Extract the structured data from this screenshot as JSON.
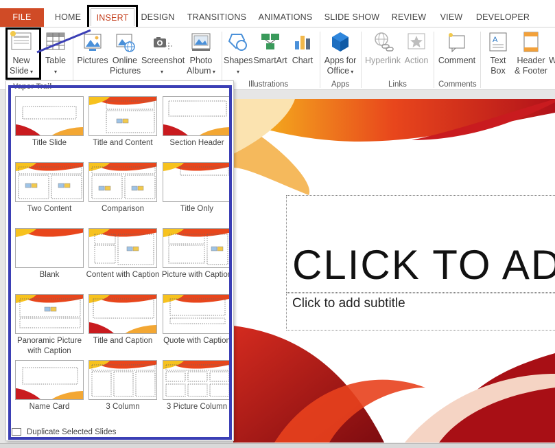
{
  "tabs": [
    {
      "label": "FILE"
    },
    {
      "label": "HOME"
    },
    {
      "label": "INSERT"
    },
    {
      "label": "DESIGN"
    },
    {
      "label": "TRANSITIONS"
    },
    {
      "label": "ANIMATIONS"
    },
    {
      "label": "SLIDE SHOW"
    },
    {
      "label": "REVIEW"
    },
    {
      "label": "VIEW"
    },
    {
      "label": "DEVELOPER"
    }
  ],
  "ribbon": {
    "new_slide": {
      "line1": "New",
      "line2": "Slide"
    },
    "table": {
      "line1": "Table"
    },
    "pictures": {
      "line1": "Pictures"
    },
    "online_pictures": {
      "line1": "Online",
      "line2": "Pictures"
    },
    "screenshot": {
      "line1": "Screenshot"
    },
    "photo_album": {
      "line1": "Photo",
      "line2": "Album"
    },
    "shapes": {
      "line1": "Shapes"
    },
    "smartart": {
      "line1": "SmartArt"
    },
    "chart": {
      "line1": "Chart"
    },
    "apps_for_office": {
      "line1": "Apps for",
      "line2": "Office"
    },
    "hyperlink": {
      "line1": "Hyperlink"
    },
    "action": {
      "line1": "Action"
    },
    "comment": {
      "line1": "Comment"
    },
    "text_box": {
      "line1": "Text",
      "line2": "Box"
    },
    "header_footer": {
      "line1": "Header",
      "line2": "& Footer"
    },
    "cut_off": {
      "line1": "W"
    },
    "groups": {
      "illustrations": "Illustrations",
      "apps": "Apps",
      "links": "Links",
      "comments": "Comments"
    }
  },
  "gallery": {
    "theme_name": "Vapor Trail",
    "layouts": [
      {
        "label": "Title Slide"
      },
      {
        "label": "Title and Content"
      },
      {
        "label": "Section Header"
      },
      {
        "label": "Two Content"
      },
      {
        "label": "Comparison"
      },
      {
        "label": "Title Only"
      },
      {
        "label": "Blank"
      },
      {
        "label": "Content with Caption"
      },
      {
        "label": "Picture with Caption"
      },
      {
        "label": "Panoramic Picture with Caption"
      },
      {
        "label": "Title and Caption"
      },
      {
        "label": "Quote with Caption"
      },
      {
        "label": "Name Card"
      },
      {
        "label": "3 Column"
      },
      {
        "label": "3 Picture Column"
      }
    ],
    "duplicate_label": "Duplicate Selected Slides"
  },
  "slide": {
    "title_placeholder": "CLICK TO ADD",
    "subtitle_placeholder": "Click to add subtitle"
  },
  "colors": {
    "file_tab": "#d04b26",
    "active_tab_text": "#c43e1c",
    "annotation_box": "#3b3fb5"
  }
}
